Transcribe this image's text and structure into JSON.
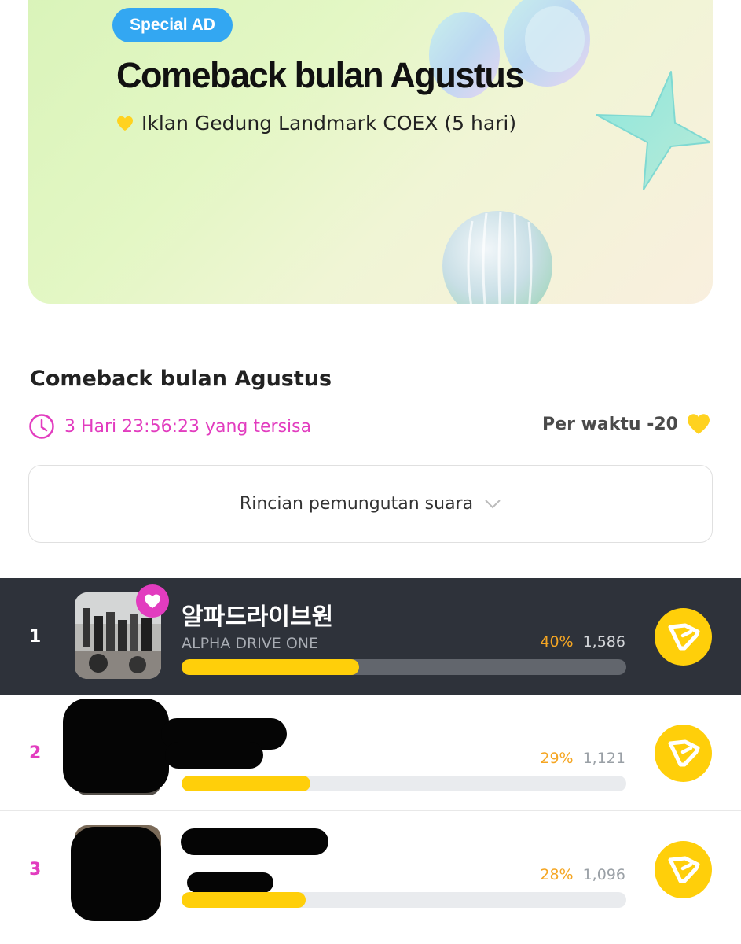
{
  "banner": {
    "badge": "Special AD",
    "title": "Comeback bulan Agustus",
    "subtitle": "Iklan Gedung Landmark COEX (5 hari)"
  },
  "vote": {
    "title": "Comeback bulan Agustus",
    "time_remaining": "3 Hari 23:56:23 yang tersisa",
    "per_time": "Per waktu -20",
    "details_label": "Rincian pemungutan suara"
  },
  "colors": {
    "accent_pink": "#e23cbf",
    "vote_yellow": "#ffcf0a",
    "percent_orange": "#f5a623",
    "badge_blue": "#33a7f2"
  },
  "rankings": [
    {
      "rank": "1",
      "name_ko": "알파드라이브원",
      "name_en": "ALPHA DRIVE ONE",
      "percent": "40%",
      "votes": "1,586",
      "bar_fraction": 0.4,
      "favorite": true
    },
    {
      "rank": "2",
      "name_ko": "",
      "name_en": "",
      "percent": "29%",
      "votes": "1,121",
      "bar_fraction": 0.29,
      "favorite": false
    },
    {
      "rank": "3",
      "name_ko": "",
      "name_en": "",
      "percent": "28%",
      "votes": "1,096",
      "bar_fraction": 0.28,
      "favorite": false
    }
  ],
  "icons": {
    "timer": "clock-icon",
    "heart": "yellow-heart-icon",
    "chevron": "chevron-down-icon",
    "vote": "vote-logo-icon",
    "favorite": "pink-heart-icon"
  }
}
